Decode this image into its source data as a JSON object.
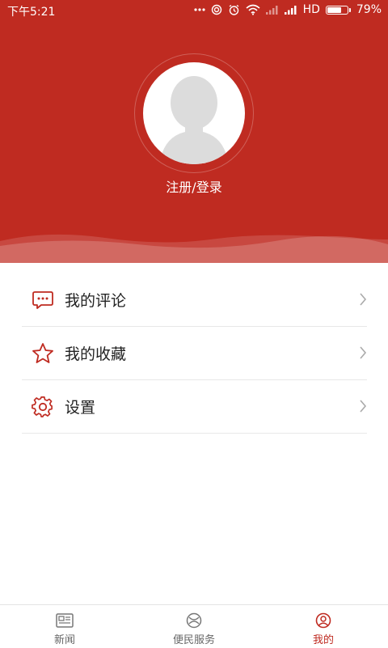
{
  "status_bar": {
    "time": "下午5:21",
    "network": "HD",
    "battery_percent_text": "79%",
    "battery_level": 0.79
  },
  "profile": {
    "login_label": "注册/登录"
  },
  "menu": {
    "items": [
      {
        "label": "我的评论",
        "icon": "comment-icon"
      },
      {
        "label": "我的收藏",
        "icon": "star-icon"
      },
      {
        "label": "设置",
        "icon": "gear-icon"
      }
    ]
  },
  "tabbar": {
    "tabs": [
      {
        "label": "新闻",
        "icon": "news-icon",
        "active": false
      },
      {
        "label": "便民服务",
        "icon": "service-icon",
        "active": false
      },
      {
        "label": "我的",
        "icon": "user-icon",
        "active": true
      }
    ]
  },
  "colors": {
    "brand": "#bf2b21",
    "text": "#222222",
    "tab_inactive": "#666666",
    "divider": "#e8e8e8"
  }
}
